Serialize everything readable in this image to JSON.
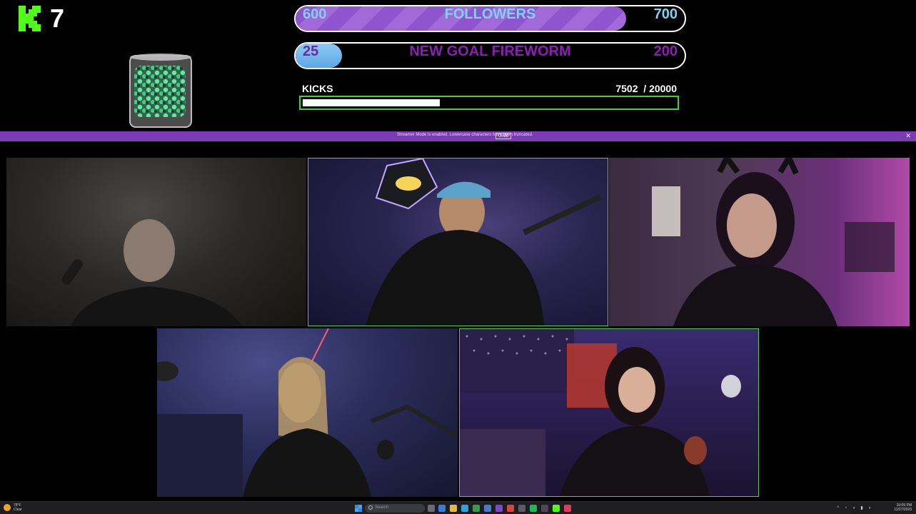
{
  "overlay": {
    "kick_count": "7",
    "followers": {
      "start": "600",
      "label": "FOLLOWERS",
      "end": "700",
      "progress": 0.85
    },
    "goal": {
      "start": "25",
      "label": "NEW GOAL FIREWORM",
      "end": "200",
      "progress": 0.12
    },
    "kicks": {
      "title": "KICKS",
      "value": "7502  / 20000",
      "progress": 0.375
    }
  },
  "notification": {
    "message": "Streamer Mode is enabled. Lowercase characters have been truncated.",
    "action_label": "Undo",
    "close_icon": "close-icon"
  },
  "participants": [
    {
      "id": "tile-1",
      "highlighted": false
    },
    {
      "id": "tile-2",
      "highlighted": true
    },
    {
      "id": "tile-3",
      "highlighted": false
    },
    {
      "id": "tile-4",
      "highlighted": false
    },
    {
      "id": "tile-5",
      "highlighted": true
    }
  ],
  "taskbar": {
    "weather": "78°F\nClear",
    "search_placeholder": "Search",
    "tray": "^ ◔ ◖ ▮ ◗",
    "clock": "10:05 PM\n11/27/2023"
  },
  "colors": {
    "accent_green": "#4ed04e",
    "kick_green": "#53fc18",
    "purple_strip": "#7a3bb5",
    "followers_fill": "#9a60d5",
    "goal_fill": "#6db2ee"
  }
}
